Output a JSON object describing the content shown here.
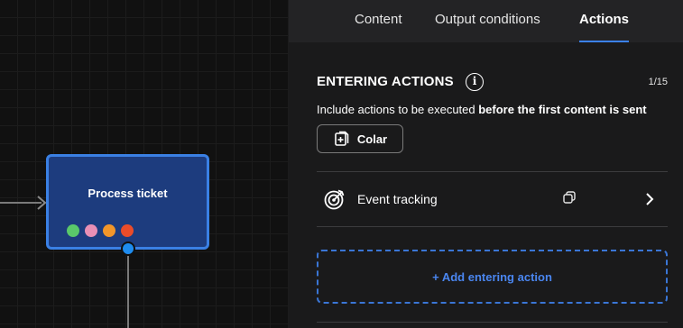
{
  "canvas": {
    "node": {
      "title": "Process ticket",
      "dot_colors": [
        "#5ac86a",
        "#e98fb5",
        "#f2962a",
        "#ea4c2a"
      ],
      "color": "#1d3c7e",
      "border_color": "#3a80e4"
    }
  },
  "panel": {
    "tabs": [
      {
        "label": "Content",
        "active": false
      },
      {
        "label": "Output conditions",
        "active": false
      },
      {
        "label": "Actions",
        "active": true
      }
    ],
    "section": {
      "title": "ENTERING ACTIONS",
      "info_icon": "info-icon",
      "counter": "1/15",
      "description_prefix": "Include actions to be executed ",
      "description_bold": "before the first content is sent"
    },
    "paste_button": {
      "label": "Colar",
      "icon": "paste-icon"
    },
    "actions": [
      {
        "label": "Event tracking",
        "icon": "target-icon",
        "copy_icon": "copy-icon",
        "nav_icon": "chevron-right-icon"
      }
    ],
    "add_action_label": "+ Add entering action"
  },
  "colors": {
    "accent": "#3b82f6",
    "handle": "#1e8cf0"
  }
}
